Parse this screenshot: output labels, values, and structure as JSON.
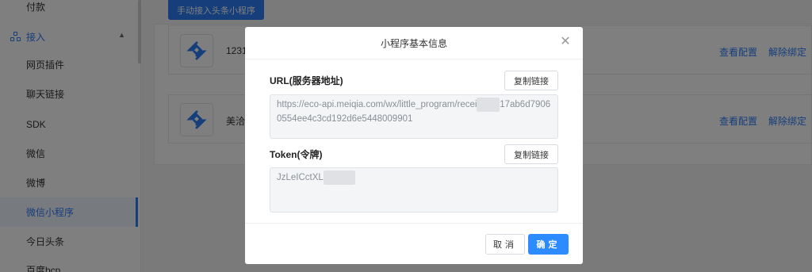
{
  "sidebar": {
    "items": [
      {
        "label": "付款"
      },
      {
        "label": "网页插件"
      },
      {
        "label": "聊天链接"
      },
      {
        "label": "SDK"
      },
      {
        "label": "微信"
      },
      {
        "label": "微博"
      },
      {
        "label": "微信小程序"
      },
      {
        "label": "今日头条"
      },
      {
        "label": "百度bcp"
      }
    ],
    "group": {
      "label": "接入",
      "icon": "grid-icon"
    }
  },
  "main": {
    "add_button": "手动接入头条小程序",
    "rows": [
      {
        "name": "1231",
        "view": "查看配置",
        "unbind": "解除绑定"
      },
      {
        "name": "美洽",
        "view": "查看配置",
        "unbind": "解除绑定"
      }
    ]
  },
  "modal": {
    "title": "小程序基本信息",
    "url_label": "URL(服务器地址)",
    "url_value_part1": "https://eco-api.meiqia.com/wx/little_program/recei",
    "url_value_part2": "17ab6d79060554ee4c3cd192d6e5448009901",
    "token_label": "Token(令牌)",
    "token_value": "JzLeICctXL",
    "copy_label": "复制链接",
    "cancel": "取消",
    "ok": "确定"
  },
  "colors": {
    "accent": "#2c7cf6",
    "primary_button": "#2c8cff"
  }
}
